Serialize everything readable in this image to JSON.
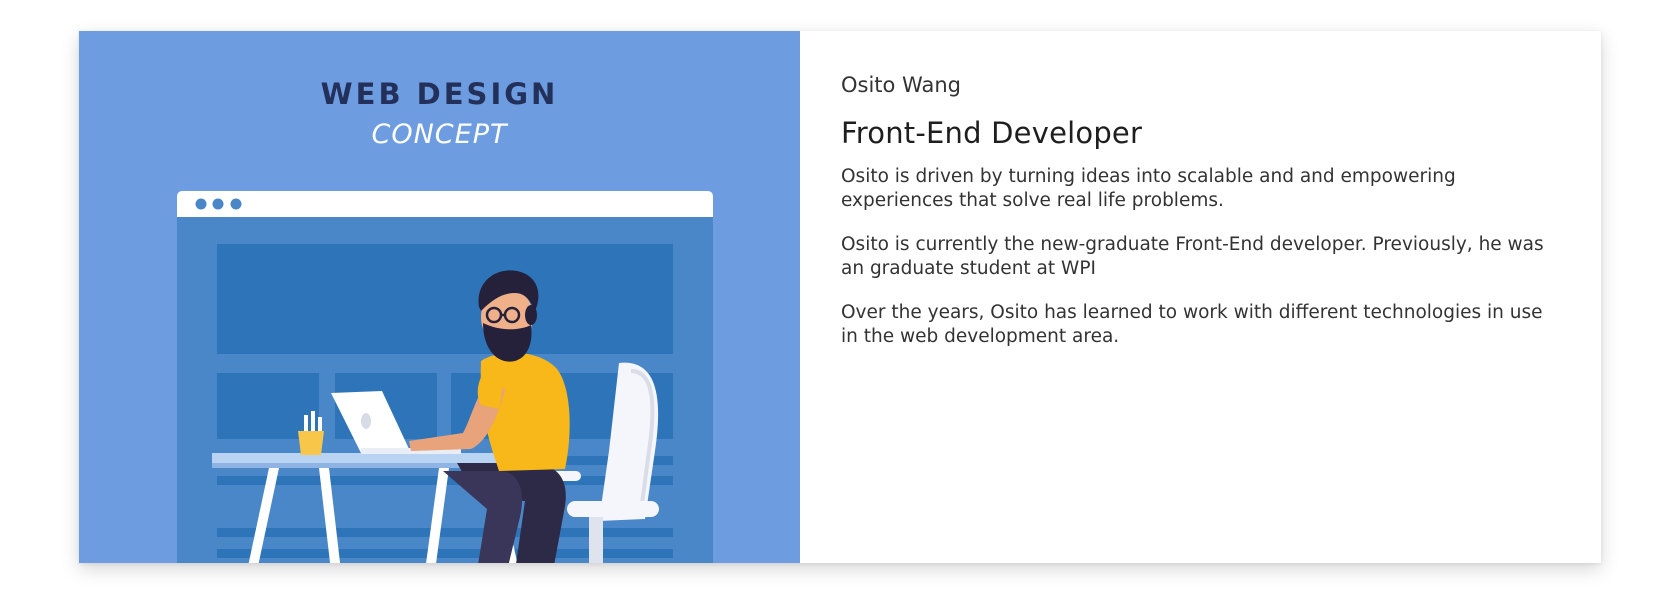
{
  "illustration": {
    "title": "WEB DESIGN",
    "subtitle": "CONCEPT"
  },
  "profile": {
    "name": "Osito Wang",
    "role": "Front-End Developer",
    "paragraphs": [
      "Osito is driven by turning ideas into scalable and and empowering experiences that solve real life problems.",
      "Osito is currently the new-graduate Front-End developer. Previously, he was an graduate student at WPI",
      "Over the years, Osito has learned to work with different technologies in use in the web development area."
    ]
  },
  "colors": {
    "panel_background": "#6d9de0",
    "browser_body": "#4a87c8",
    "browser_bar": "#ffffff",
    "title_dark": "#22305a",
    "shirt": "#f8b81a"
  }
}
